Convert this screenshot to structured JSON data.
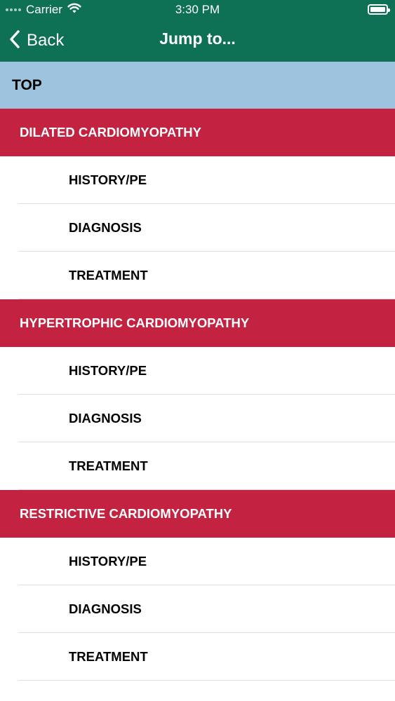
{
  "status_bar": {
    "carrier": "Carrier",
    "time": "3:30 PM"
  },
  "nav": {
    "back_label": "Back",
    "title": "Jump to..."
  },
  "list": {
    "top_label": "TOP",
    "sections": [
      {
        "title": "DILATED CARDIOMYOPATHY",
        "items": [
          "HISTORY/PE",
          "DIAGNOSIS",
          "TREATMENT"
        ]
      },
      {
        "title": "HYPERTROPHIC CARDIOMYOPATHY",
        "items": [
          "HISTORY/PE",
          "DIAGNOSIS",
          "TREATMENT"
        ]
      },
      {
        "title": "RESTRICTIVE CARDIOMYOPATHY",
        "items": [
          "HISTORY/PE",
          "DIAGNOSIS",
          "TREATMENT"
        ]
      }
    ]
  },
  "colors": {
    "nav_bar": "#0e7156",
    "top_row": "#9ec3de",
    "section_header": "#c42241"
  }
}
